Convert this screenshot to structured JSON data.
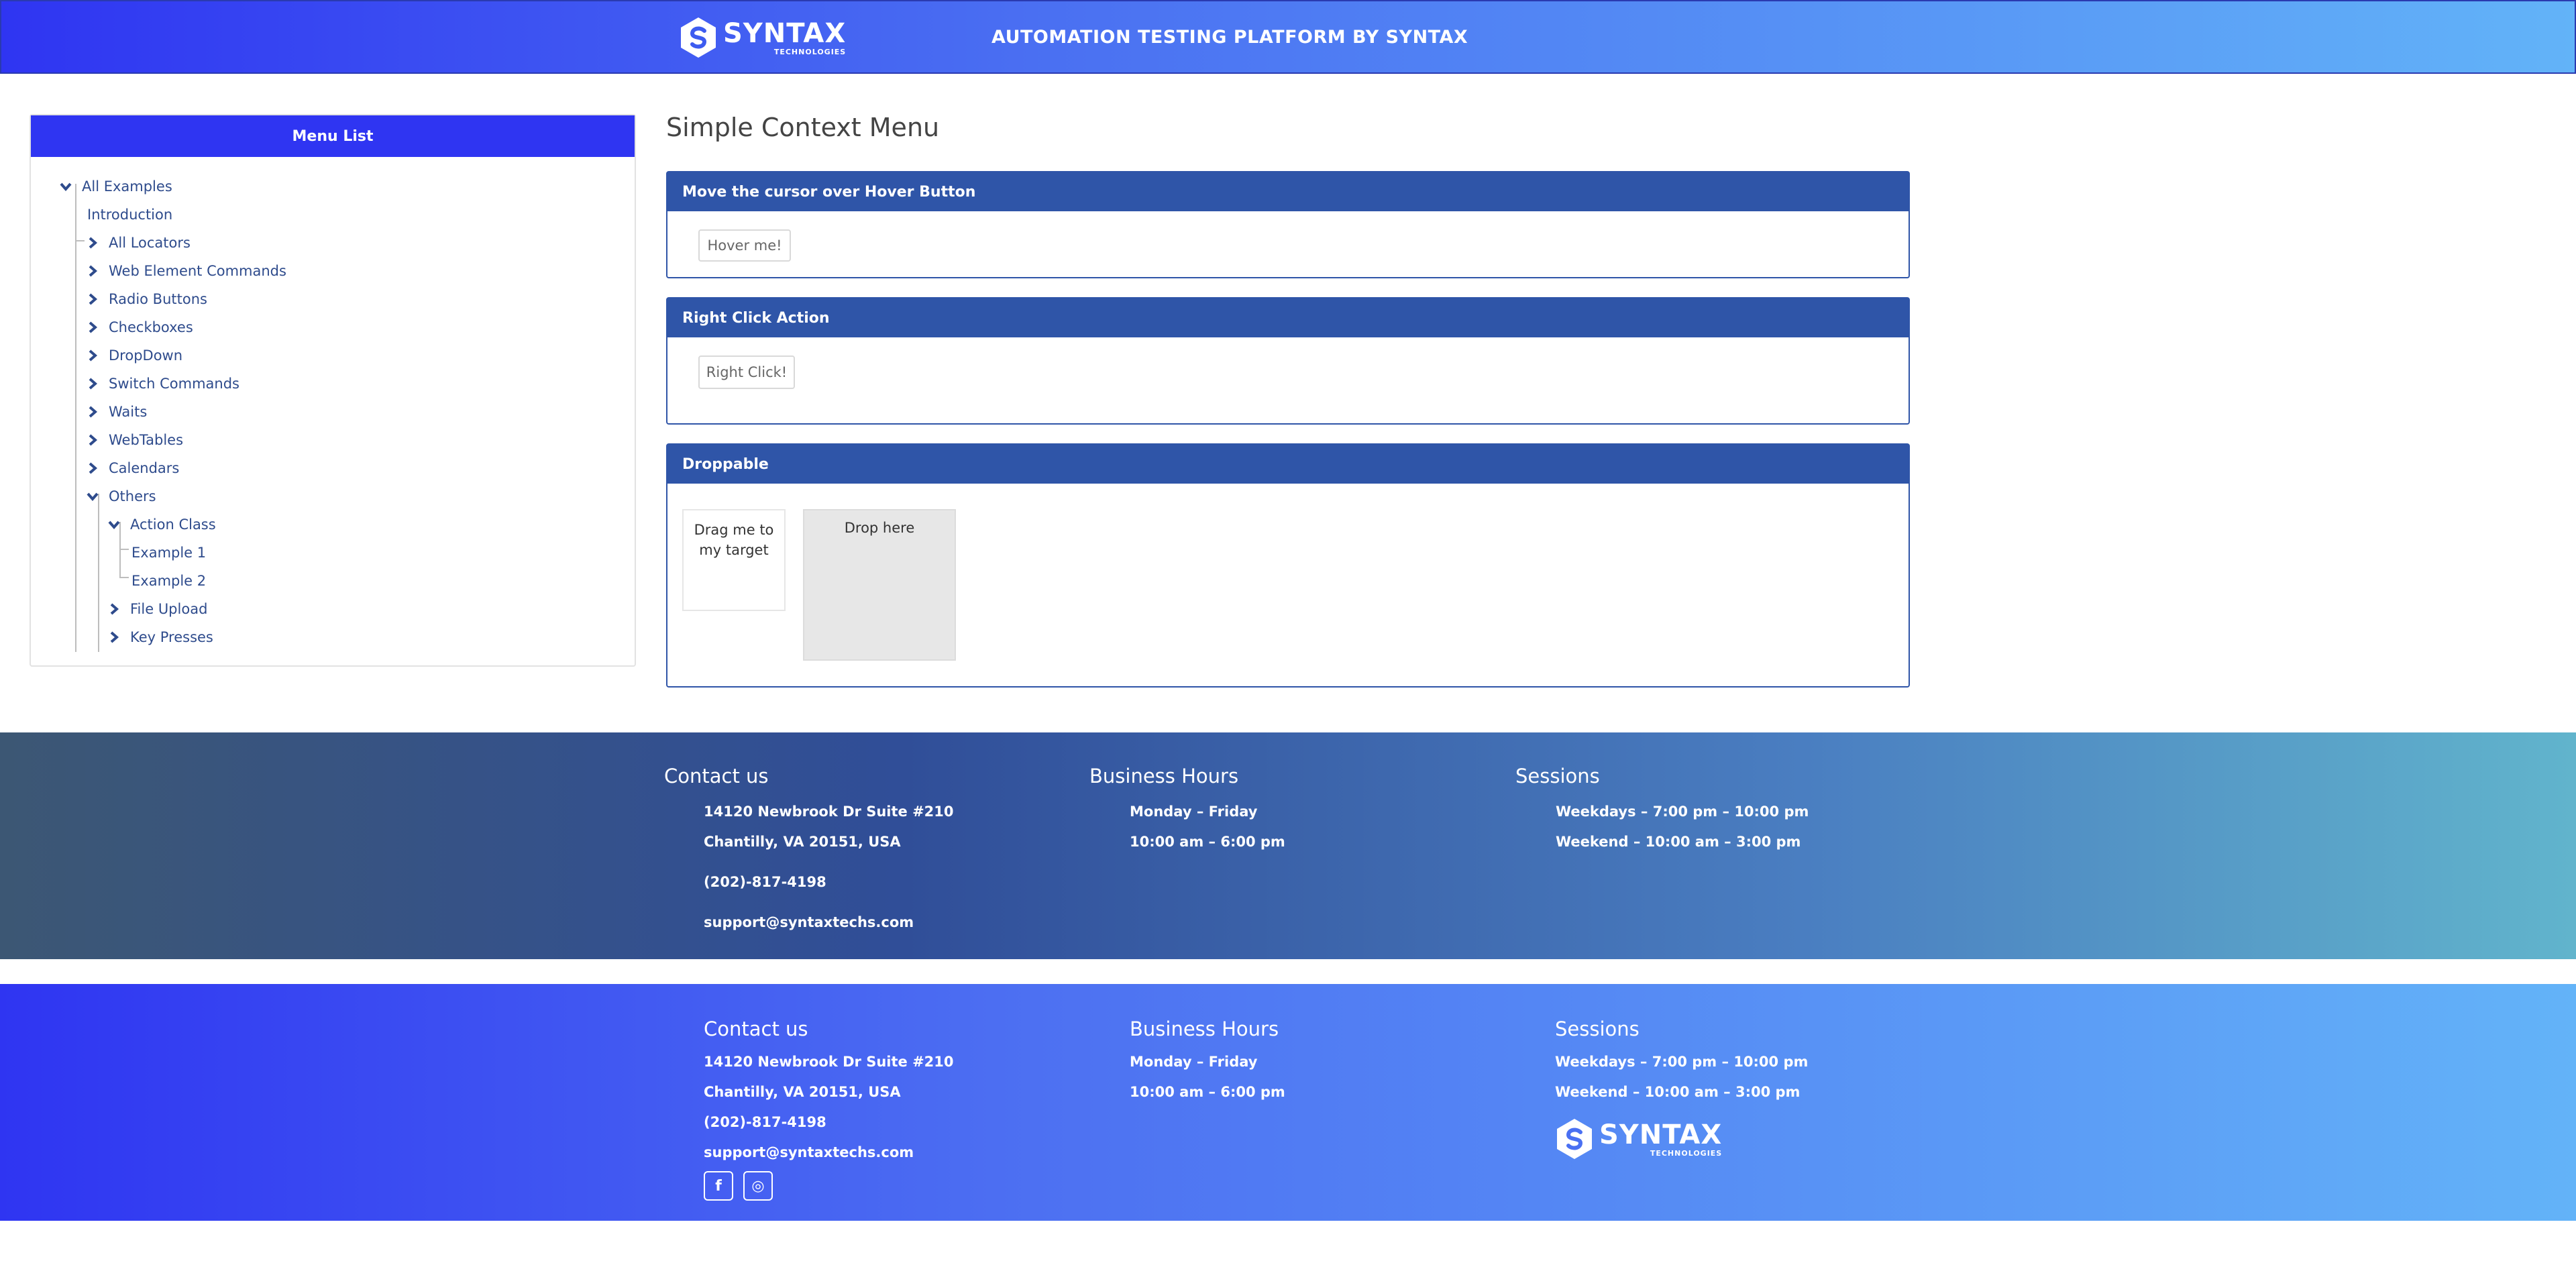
{
  "header": {
    "brand": "SYNTAX",
    "brand_sub": "TECHNOLOGIES",
    "platform_title": "AUTOMATION TESTING PLATFORM BY SYNTAX"
  },
  "sidebar": {
    "title": "Menu List",
    "items": [
      {
        "label": "All Examples",
        "state": "expanded"
      },
      {
        "label": "Introduction",
        "state": "leaf"
      },
      {
        "label": "All Locators",
        "state": "collapsed"
      },
      {
        "label": "Web Element Commands",
        "state": "collapsed"
      },
      {
        "label": "Radio Buttons",
        "state": "collapsed"
      },
      {
        "label": "Checkboxes",
        "state": "collapsed"
      },
      {
        "label": "DropDown",
        "state": "collapsed"
      },
      {
        "label": "Switch Commands",
        "state": "collapsed"
      },
      {
        "label": "Waits",
        "state": "collapsed"
      },
      {
        "label": "WebTables",
        "state": "collapsed"
      },
      {
        "label": "Calendars",
        "state": "collapsed"
      },
      {
        "label": "Others",
        "state": "expanded"
      },
      {
        "label": "Action Class",
        "state": "expanded"
      },
      {
        "label": "Example 1",
        "state": "leaf"
      },
      {
        "label": "Example 2",
        "state": "leaf"
      },
      {
        "label": "File Upload",
        "state": "collapsed"
      },
      {
        "label": "Key Presses",
        "state": "collapsed"
      }
    ]
  },
  "main": {
    "page_title": "Simple Context Menu",
    "hover_card": {
      "title": "Move the cursor over Hover Button",
      "button": "Hover me!"
    },
    "right_click_card": {
      "title": "Right Click Action",
      "button": "Right Click!"
    },
    "droppable_card": {
      "title": "Droppable",
      "draggable": "Drag me to my target",
      "drop_target": "Drop here"
    }
  },
  "footer_top": {
    "contact": {
      "heading": "Contact us",
      "address1": "14120 Newbrook Dr Suite #210",
      "address2": "Chantilly, VA 20151, USA",
      "phone": "(202)-817-4198",
      "email": "support@syntaxtechs.com"
    },
    "hours": {
      "heading": "Business Hours",
      "days": "Monday – Friday",
      "time": "10:00 am – 6:00 pm"
    },
    "sessions": {
      "heading": "Sessions",
      "weekdays": "Weekdays – 7:00 pm – 10:00 pm",
      "weekend": "Weekend – 10:00 am – 3:00 pm"
    }
  },
  "footer_bottom": {
    "contact": {
      "heading": "Contact us",
      "address1": "14120 Newbrook Dr Suite #210",
      "address2": "Chantilly, VA 20151, USA",
      "phone": "(202)-817-4198",
      "email": "support@syntaxtechs.com"
    },
    "hours": {
      "heading": "Business Hours",
      "days": "Monday – Friday",
      "time": "10:00 am – 6:00 pm"
    },
    "sessions": {
      "heading": "Sessions",
      "weekdays": "Weekdays – 7:00 pm – 10:00 pm",
      "weekend": "Weekend – 10:00 am – 3:00 pm"
    },
    "social": [
      {
        "icon": "facebook-icon",
        "glyph": "f"
      },
      {
        "icon": "instagram-icon",
        "glyph": "◎"
      }
    ],
    "brand": "SYNTAX",
    "brand_sub": "TECHNOLOGIES"
  },
  "colors": {
    "brand_blue": "#2f35f2",
    "card_header": "#2f55a8",
    "tree_text": "#2e4b8c"
  }
}
